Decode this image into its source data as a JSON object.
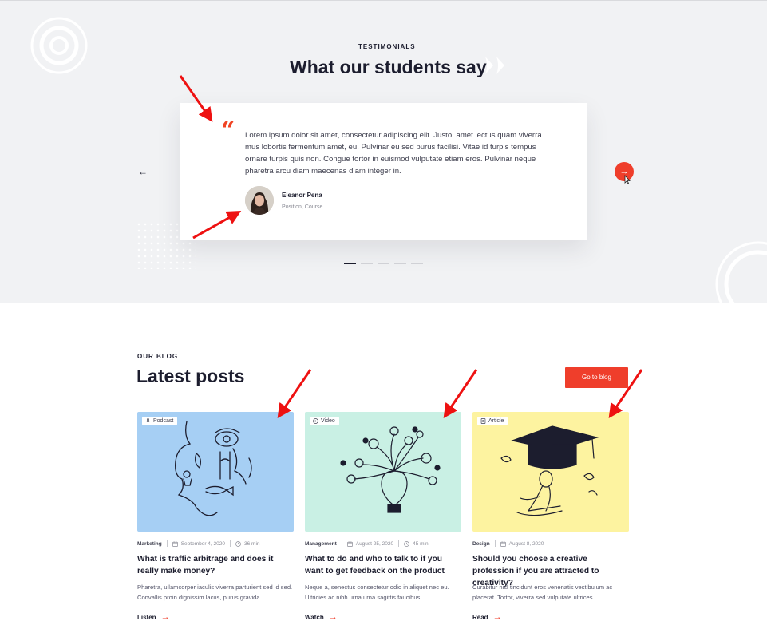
{
  "testimonials": {
    "eyebrow": "TESTIMONIALS",
    "title": "What our students say",
    "quote_mark": "“",
    "text": "Lorem ipsum dolor sit amet, consectetur adipiscing elit. Justo, amet lectus quam viverra mus lobortis fermentum amet, eu. Pulvinar eu sed purus facilisi. Vitae id turpis tempus ornare turpis quis non. Congue tortor in euismod vulputate etiam eros. Pulvinar neque pharetra arcu diam maecenas diam integer in.",
    "author_name": "Eleanor Pena",
    "author_role": "Position, Course",
    "prev_icon": "←",
    "next_icon": "→",
    "slide_count": 5,
    "active_slide": 1
  },
  "blog": {
    "eyebrow": "OUR BLOG",
    "title": "Latest posts",
    "cta_label": "Go to blog",
    "posts": [
      {
        "tag": "Podcast",
        "tag_icon": "microphone-icon",
        "category": "Marketing",
        "date": "September 4, 2020",
        "duration": "36 min",
        "title": "What is traffic arbitrage and does it really make money?",
        "excerpt": "Pharetra, ullamcorper iaculis viverra parturient sed id sed. Convallis proin dignissim lacus, purus gravida...",
        "link_label": "Listen",
        "link_icon": "→",
        "image_bg": "#a6cff4"
      },
      {
        "tag": "Video",
        "tag_icon": "play-circle-icon",
        "category": "Management",
        "date": "August 25, 2020",
        "duration": "45 min",
        "title": "What to do and who to talk to if you want to get feedback on the product",
        "excerpt": "Neque a, senectus consectetur odio in aliquet nec eu. Ultricies ac nibh urna urna sagittis faucibus...",
        "link_label": "Watch",
        "link_icon": "→",
        "image_bg": "#c9f0e4"
      },
      {
        "tag": "Article",
        "tag_icon": "document-icon",
        "category": "Design",
        "date": "August 8, 2020",
        "duration": "",
        "title": "Should you choose a creative profession if you are attracted to creativity?",
        "excerpt": "Curabitur nisl tincidunt eros venenatis vestibulum ac placerat. Tortor, viverra sed vulputate ultrices...",
        "link_label": "Read",
        "link_icon": "→",
        "image_bg": "#fdf3a0"
      }
    ]
  },
  "colors": {
    "accent": "#ef3e2b",
    "dark": "#1c1d2e",
    "section_bg": "#f1f2f4",
    "annotation": "#ee1111"
  }
}
